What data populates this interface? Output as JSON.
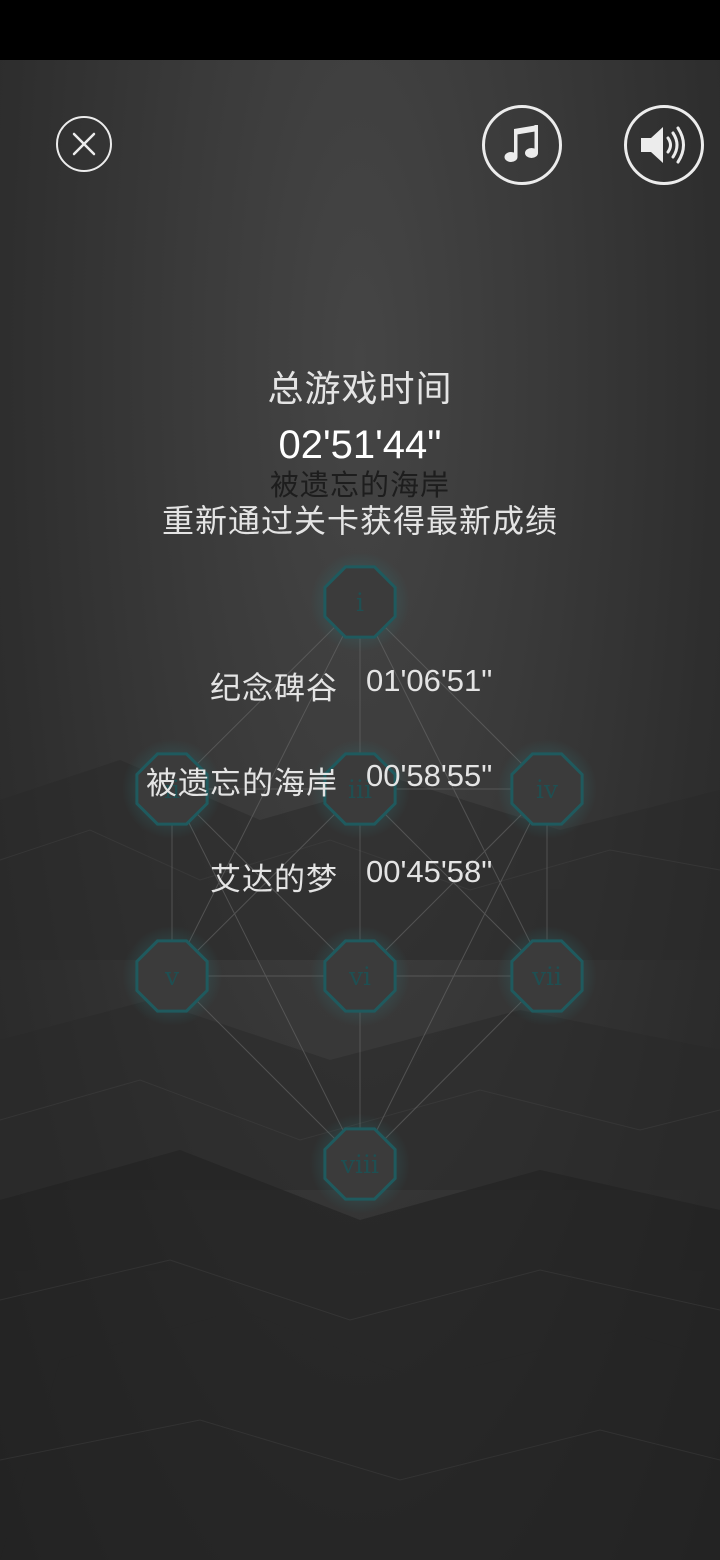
{
  "controls": {
    "close": "close-icon",
    "music": "music-note-icon",
    "sound": "speaker-icon"
  },
  "summary": {
    "total_label": "总游戏时间",
    "total_time": "02'51'44\"",
    "faded_title": "被遗忘的海岸",
    "hint": "重新通过关卡获得最新成绩"
  },
  "records": [
    {
      "name": "纪念碑谷",
      "time": "01'06'51\""
    },
    {
      "name": "被遗忘的海岸",
      "time": "00'58'55\""
    },
    {
      "name": "艾达的梦",
      "time": "00'45'58\""
    }
  ],
  "level_nodes": [
    {
      "label": "i"
    },
    {
      "label": "ii"
    },
    {
      "label": "iii"
    },
    {
      "label": "iv"
    },
    {
      "label": "v"
    },
    {
      "label": "vi"
    },
    {
      "label": "vii"
    },
    {
      "label": "viii"
    }
  ],
  "colors": {
    "node_fill": "#3b3b3b",
    "node_stroke": "#1f5a5e",
    "node_label": "#1f4f52",
    "text": "#e4e4e4"
  }
}
